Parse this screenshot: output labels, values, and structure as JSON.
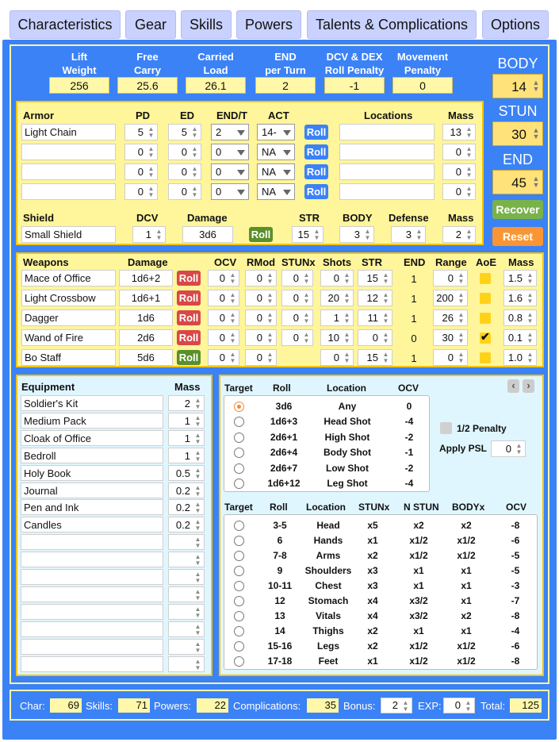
{
  "tabs": [
    "Characteristics",
    "Gear",
    "Skills",
    "Powers",
    "Talents & Complications",
    "Options"
  ],
  "header": {
    "lift_weight_label": "Lift\nWeight",
    "lift_weight": "256",
    "free_carry_label": "Free\nCarry",
    "free_carry": "25.6",
    "carried_load_label": "Carried\nLoad",
    "carried_load": "26.1",
    "end_per_turn_label": "END\nper Turn",
    "end_per_turn": "2",
    "dcv_dex_label": "DCV & DEX\nRoll Penalty",
    "dcv_dex": "-1",
    "movement_label": "Movement\nPenalty",
    "movement": "0"
  },
  "stats": {
    "body_label": "BODY",
    "body": "14",
    "stun_label": "STUN",
    "stun": "30",
    "end_label": "END",
    "end": "45",
    "recover": "Recover",
    "reset": "Reset"
  },
  "armor": {
    "headers": {
      "armor": "Armor",
      "pd": "PD",
      "ed": "ED",
      "endt": "END/T",
      "act": "ACT",
      "locations": "Locations",
      "mass": "Mass"
    },
    "rows": [
      {
        "name": "Light Chain",
        "pd": "5",
        "ed": "5",
        "endt": "2",
        "act": "14-",
        "loc": "",
        "mass": "13"
      },
      {
        "name": "",
        "pd": "0",
        "ed": "0",
        "endt": "0",
        "act": "NA",
        "loc": "",
        "mass": "0"
      },
      {
        "name": "",
        "pd": "0",
        "ed": "0",
        "endt": "0",
        "act": "NA",
        "loc": "",
        "mass": "0"
      },
      {
        "name": "",
        "pd": "0",
        "ed": "0",
        "endt": "0",
        "act": "NA",
        "loc": "",
        "mass": "0"
      }
    ],
    "roll": "Roll"
  },
  "shield": {
    "headers": {
      "shield": "Shield",
      "dcv": "DCV",
      "damage": "Damage",
      "str": "STR",
      "body": "BODY",
      "defense": "Defense",
      "mass": "Mass"
    },
    "name": "Small Shield",
    "dcv": "1",
    "damage": "3d6",
    "str": "15",
    "body": "3",
    "defense": "3",
    "mass": "2",
    "roll": "Roll"
  },
  "weapons": {
    "headers": {
      "weapons": "Weapons",
      "damage": "Damage",
      "ocv": "OCV",
      "rmod": "RMod",
      "stunx": "STUNx",
      "shots": "Shots",
      "str": "STR",
      "end": "END",
      "range": "Range",
      "aoe": "AoE",
      "mass": "Mass"
    },
    "rows": [
      {
        "name": "Mace of Office",
        "damage": "1d6+2",
        "ocv": "0",
        "rmod": "0",
        "stunx": "0",
        "shots": "0",
        "str": "15",
        "end": "1",
        "range": "0",
        "aoe": false,
        "mass": "1.5",
        "roll_color": "red"
      },
      {
        "name": "Light Crossbow",
        "damage": "1d6+1",
        "ocv": "0",
        "rmod": "0",
        "stunx": "0",
        "shots": "20",
        "str": "12",
        "end": "1",
        "range": "200",
        "aoe": false,
        "mass": "1.6",
        "roll_color": "red"
      },
      {
        "name": "Dagger",
        "damage": "1d6",
        "ocv": "0",
        "rmod": "0",
        "stunx": "0",
        "shots": "1",
        "str": "11",
        "end": "1",
        "range": "26",
        "aoe": false,
        "mass": "0.8",
        "roll_color": "red"
      },
      {
        "name": "Wand of Fire",
        "damage": "2d6",
        "ocv": "0",
        "rmod": "0",
        "stunx": "0",
        "shots": "10",
        "str": "0",
        "end": "0",
        "range": "30",
        "aoe": true,
        "mass": "0.1",
        "roll_color": "red"
      },
      {
        "name": "Bo Staff",
        "damage": "5d6",
        "ocv": "0",
        "rmod": "0",
        "stunx": "",
        "shots": "0",
        "str": "15",
        "end": "1",
        "range": "0",
        "aoe": false,
        "mass": "1.0",
        "roll_color": "green"
      }
    ],
    "roll": "Roll"
  },
  "equipment": {
    "headers": {
      "equipment": "Equipment",
      "mass": "Mass"
    },
    "rows": [
      {
        "name": "Soldier's Kit",
        "mass": "2"
      },
      {
        "name": "Medium Pack",
        "mass": "1"
      },
      {
        "name": "Cloak of Office",
        "mass": "1"
      },
      {
        "name": "Bedroll",
        "mass": "1"
      },
      {
        "name": "Holy Book",
        "mass": "0.5"
      },
      {
        "name": "Journal",
        "mass": "0.2"
      },
      {
        "name": "Pen and Ink",
        "mass": "0.2"
      },
      {
        "name": "Candles",
        "mass": "0.2"
      },
      {
        "name": "",
        "mass": ""
      },
      {
        "name": "",
        "mass": ""
      },
      {
        "name": "",
        "mass": ""
      },
      {
        "name": "",
        "mass": ""
      },
      {
        "name": "",
        "mass": ""
      },
      {
        "name": "",
        "mass": ""
      },
      {
        "name": "",
        "mass": ""
      },
      {
        "name": "",
        "mass": ""
      }
    ]
  },
  "target1": {
    "headers": {
      "target": "Target",
      "roll": "Roll",
      "location": "Location",
      "ocv": "OCV"
    },
    "rows": [
      {
        "roll": "3d6",
        "location": "Any",
        "ocv": "0",
        "selected": true
      },
      {
        "roll": "1d6+3",
        "location": "Head Shot",
        "ocv": "-4",
        "selected": false
      },
      {
        "roll": "2d6+1",
        "location": "High Shot",
        "ocv": "-2",
        "selected": false
      },
      {
        "roll": "2d6+4",
        "location": "Body Shot",
        "ocv": "-1",
        "selected": false
      },
      {
        "roll": "2d6+7",
        "location": "Low Shot",
        "ocv": "-2",
        "selected": false
      },
      {
        "roll": "1d6+12",
        "location": "Leg Shot",
        "ocv": "-4",
        "selected": false
      }
    ],
    "half_penalty": "1/2 Penalty",
    "apply_psl": "Apply PSL",
    "psl_value": "0",
    "prev": "‹",
    "next": "›"
  },
  "target2": {
    "headers": {
      "target": "Target",
      "roll": "Roll",
      "location": "Location",
      "stunx": "STUNx",
      "nstun": "N STUN",
      "bodyx": "BODYx",
      "ocv": "OCV"
    },
    "rows": [
      {
        "roll": "3-5",
        "location": "Head",
        "stunx": "x5",
        "nstun": "x2",
        "bodyx": "x2",
        "ocv": "-8"
      },
      {
        "roll": "6",
        "location": "Hands",
        "stunx": "x1",
        "nstun": "x1/2",
        "bodyx": "x1/2",
        "ocv": "-6"
      },
      {
        "roll": "7-8",
        "location": "Arms",
        "stunx": "x2",
        "nstun": "x1/2",
        "bodyx": "x1/2",
        "ocv": "-5"
      },
      {
        "roll": "9",
        "location": "Shoulders",
        "stunx": "x3",
        "nstun": "x1",
        "bodyx": "x1",
        "ocv": "-5"
      },
      {
        "roll": "10-11",
        "location": "Chest",
        "stunx": "x3",
        "nstun": "x1",
        "bodyx": "x1",
        "ocv": "-3"
      },
      {
        "roll": "12",
        "location": "Stomach",
        "stunx": "x4",
        "nstun": "x3/2",
        "bodyx": "x1",
        "ocv": "-7"
      },
      {
        "roll": "13",
        "location": "Vitals",
        "stunx": "x4",
        "nstun": "x3/2",
        "bodyx": "x2",
        "ocv": "-8"
      },
      {
        "roll": "14",
        "location": "Thighs",
        "stunx": "x2",
        "nstun": "x1",
        "bodyx": "x1",
        "ocv": "-4"
      },
      {
        "roll": "15-16",
        "location": "Legs",
        "stunx": "x2",
        "nstun": "x1/2",
        "bodyx": "x1/2",
        "ocv": "-6"
      },
      {
        "roll": "17-18",
        "location": "Feet",
        "stunx": "x1",
        "nstun": "x1/2",
        "bodyx": "x1/2",
        "ocv": "-8"
      }
    ]
  },
  "footer": {
    "char_label": "Char:",
    "char": "69",
    "skills_label": "Skills:",
    "skills": "71",
    "powers_label": "Powers:",
    "powers": "22",
    "comp_label": "Complications:",
    "comp": "35",
    "bonus_label": "Bonus:",
    "bonus": "2",
    "exp_label": "EXP:",
    "exp": "0",
    "total_label": "Total:",
    "total": "125"
  },
  "colors": {
    "background": "#3b82f6",
    "panel_yellow": "#fff59a",
    "panel_cyan": "#dff6ff",
    "border": "#f5c400",
    "roll_blue": "#3b82f6",
    "roll_red": "#d84848",
    "roll_green": "#5a8f2a",
    "recover": "#7ab24a",
    "reset": "#fa9533"
  },
  "icons": {
    "spinner": "spinner-icon",
    "dropdown": "chevron-down-icon",
    "checkmark": "check-icon"
  }
}
